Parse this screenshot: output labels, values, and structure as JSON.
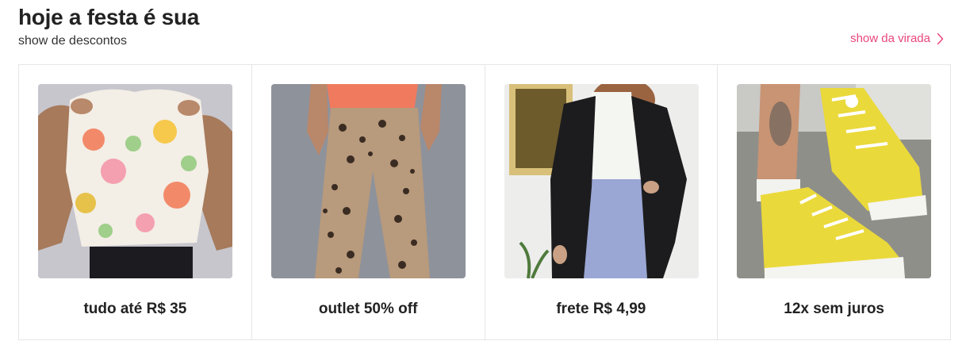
{
  "header": {
    "title": "hoje a festa é sua",
    "subtitle": "show de descontos",
    "link_label": "show da virada"
  },
  "colors": {
    "accent": "#e8467c",
    "text": "#222222",
    "border": "#e6e6e6"
  },
  "cards": [
    {
      "label": "tudo até R$ 35",
      "image": "floral-shirt-photo"
    },
    {
      "label": "outlet 50% off",
      "image": "leopard-pants-photo"
    },
    {
      "label": "frete R$ 4,99",
      "image": "black-blazer-photo"
    },
    {
      "label": "12x sem juros",
      "image": "yellow-sneakers-photo"
    }
  ]
}
